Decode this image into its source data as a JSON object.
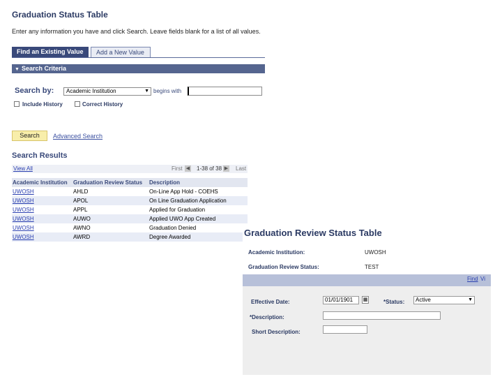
{
  "page": {
    "title": "Graduation Status Table",
    "instructions": "Enter any information you have and click Search. Leave fields blank for a list of all values."
  },
  "tabs": [
    {
      "label": "Find an Existing Value"
    },
    {
      "label": "Add a New Value"
    }
  ],
  "criteria": {
    "section_label": "Search Criteria",
    "search_by_label": "Search by:",
    "search_by_value": "Academic Institution",
    "operator_label": "begins with",
    "search_value": "",
    "include_history_label": "Include History",
    "correct_history_label": "Correct History"
  },
  "actions": {
    "search_label": "Search",
    "advanced_search_label": "Advanced Search"
  },
  "results": {
    "title": "Search Results",
    "view_all": "View All",
    "first": "First",
    "range": "1-38 of 38",
    "last": "Last",
    "columns": [
      "Academic Institution",
      "Graduation Review Status",
      "Description"
    ],
    "rows": [
      {
        "inst": "UWOSH",
        "status": "AHLD",
        "desc": "On-Line App Hold - COEHS"
      },
      {
        "inst": "UWOSH",
        "status": "APOL",
        "desc": "On Line Graduation Application"
      },
      {
        "inst": "UWOSH",
        "status": "APPL",
        "desc": "Applied for Graduation"
      },
      {
        "inst": "UWOSH",
        "status": "AUWO",
        "desc": "Applied UWO App Created"
      },
      {
        "inst": "UWOSH",
        "status": "AWNO",
        "desc": "Graduation Denied"
      },
      {
        "inst": "UWOSH",
        "status": "AWRD",
        "desc": "Degree Awarded"
      }
    ]
  },
  "detail": {
    "title": "Graduation Review Status Table",
    "academic_institution_label": "Academic Institution:",
    "academic_institution_value": "UWOSH",
    "status_label": "Graduation Review Status:",
    "status_value": "TEST",
    "find_label": "Find",
    "view_label": "Vi",
    "effdt_label": "Effective Date:",
    "effdt_value": "01/01/1901",
    "status_field_label": "*Status:",
    "status_field_value": "Active",
    "description_label": "*Description:",
    "description_value": "",
    "short_description_label": "Short Description:",
    "short_description_value": ""
  },
  "colors": {
    "header_bar": "#55658f",
    "active_tab": "#39497a",
    "search_button": "#f8eeaa",
    "link": "#2a3fb0"
  }
}
